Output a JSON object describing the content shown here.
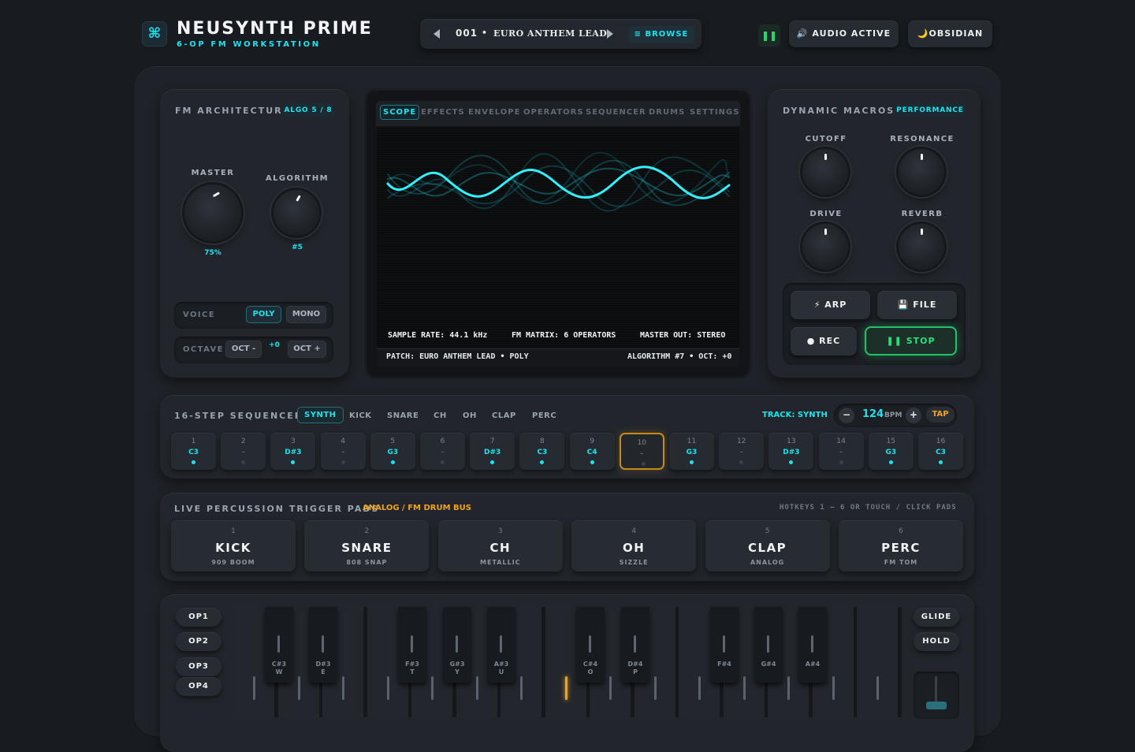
{
  "header": {
    "logo_icon": "command-icon",
    "logo_glyph": "⌘",
    "title": "NEUSYNTH PRIME",
    "subtitle": "6-OP FM WORKSTATION",
    "preset_number": "001",
    "preset_separator": "•",
    "preset_name": "EURO ANTHEM LEAD",
    "browse_label": "≡ BROWSE",
    "pause_glyph": "❚❚",
    "audio_label": "🔊 AUDIO ACTIVE",
    "theme_label": "🌙OBSIDIAN"
  },
  "fm": {
    "title": "FM ARCHITECTURE",
    "algo_badge": "ALGO 5 / 8",
    "master_label": "MASTER",
    "master_value": "75%",
    "master_level": 0.75,
    "algorithm_label": "ALGORITHM",
    "algorithm_value": "#5",
    "voice_label": "VOICE",
    "voice_options": [
      "POLY",
      "MONO"
    ],
    "voice_selected": "POLY",
    "octave_label": "OCTAVE",
    "oct_down": "OCT -",
    "oct_value": "+0",
    "oct_up": "OCT +"
  },
  "display": {
    "tabs": [
      "SCOPE",
      "EFFECTS",
      "ENVELOPE",
      "OPERATORS",
      "SEQUENCER",
      "DRUMS",
      "SETTINGS"
    ],
    "active_tab": "SCOPE",
    "sample_rate": "SAMPLE RATE: 44.1 kHz",
    "fm_matrix": "FM MATRIX: 6 OPERATORS",
    "master_out": "MASTER OUT: STEREO",
    "patch_line": "PATCH: EURO ANTHEM LEAD • POLY",
    "algo_line": "ALGORITHM #7 • OCT: +0"
  },
  "macros": {
    "title": "DYNAMIC MACROS",
    "badge": "PERFORMANCE",
    "knobs": [
      {
        "label": "CUTOFF",
        "level": 0.5
      },
      {
        "label": "RESONANCE",
        "level": 0.5
      },
      {
        "label": "DRIVE",
        "level": 0.5
      },
      {
        "label": "REVERB",
        "level": 0.5
      }
    ],
    "arp": "⚡ ARP",
    "file": "💾 FILE",
    "rec": "● REC",
    "stop": "❚❚ STOP"
  },
  "sequencer": {
    "title": "16-STEP SEQUENCER",
    "tracks": [
      "SYNTH",
      "KICK",
      "SNARE",
      "CH",
      "OH",
      "CLAP",
      "PERC"
    ],
    "active_track": "SYNTH",
    "track_label": "TRACK: SYNTH",
    "bpm": "124",
    "bpm_unit": "BPM",
    "minus": "−",
    "plus": "+",
    "tap": "TAP",
    "current_step": 10,
    "steps": [
      {
        "n": "1",
        "note": "C3",
        "on": true
      },
      {
        "n": "2",
        "note": "–",
        "on": false
      },
      {
        "n": "3",
        "note": "D#3",
        "on": true
      },
      {
        "n": "4",
        "note": "–",
        "on": false
      },
      {
        "n": "5",
        "note": "G3",
        "on": true
      },
      {
        "n": "6",
        "note": "–",
        "on": false
      },
      {
        "n": "7",
        "note": "D#3",
        "on": true
      },
      {
        "n": "8",
        "note": "C3",
        "on": true
      },
      {
        "n": "9",
        "note": "C4",
        "on": true
      },
      {
        "n": "10",
        "note": "–",
        "on": false
      },
      {
        "n": "11",
        "note": "G3",
        "on": true
      },
      {
        "n": "12",
        "note": "–",
        "on": false
      },
      {
        "n": "13",
        "note": "D#3",
        "on": true
      },
      {
        "n": "14",
        "note": "–",
        "on": false
      },
      {
        "n": "15",
        "note": "G3",
        "on": true
      },
      {
        "n": "16",
        "note": "C3",
        "on": true
      }
    ]
  },
  "pads": {
    "title": "LIVE PERCUSSION TRIGGER PADS",
    "subtitle": "ANALOG / FM DRUM BUS",
    "hint": "HOTKEYS 1 – 6 OR TOUCH / CLICK PADS",
    "items": [
      {
        "n": "1",
        "name": "KICK",
        "sub": "909 BOOM"
      },
      {
        "n": "2",
        "name": "SNARE",
        "sub": "808 SNAP"
      },
      {
        "n": "3",
        "name": "CH",
        "sub": "METALLIC"
      },
      {
        "n": "4",
        "name": "OH",
        "sub": "SIZZLE"
      },
      {
        "n": "5",
        "name": "CLAP",
        "sub": "ANALOG"
      },
      {
        "n": "6",
        "name": "PERC",
        "sub": "FM TOM"
      }
    ]
  },
  "keyboard": {
    "operators": [
      "OP1",
      "OP2",
      "OP3",
      "OP4"
    ],
    "glide": "GLIDE",
    "hold": "HOLD",
    "black_keys": [
      {
        "note": "C#3",
        "key": "W"
      },
      {
        "note": "D#3",
        "key": "E"
      },
      {
        "note": "F#3",
        "key": "T"
      },
      {
        "note": "G#3",
        "key": "Y"
      },
      {
        "note": "A#3",
        "key": "U"
      },
      {
        "note": "C#4",
        "key": "O"
      },
      {
        "note": "D#4",
        "key": "P"
      },
      {
        "note": "F#4",
        "key": ""
      },
      {
        "note": "G#4",
        "key": ""
      },
      {
        "note": "A#4",
        "key": ""
      }
    ],
    "lit_white_key": 7
  }
}
